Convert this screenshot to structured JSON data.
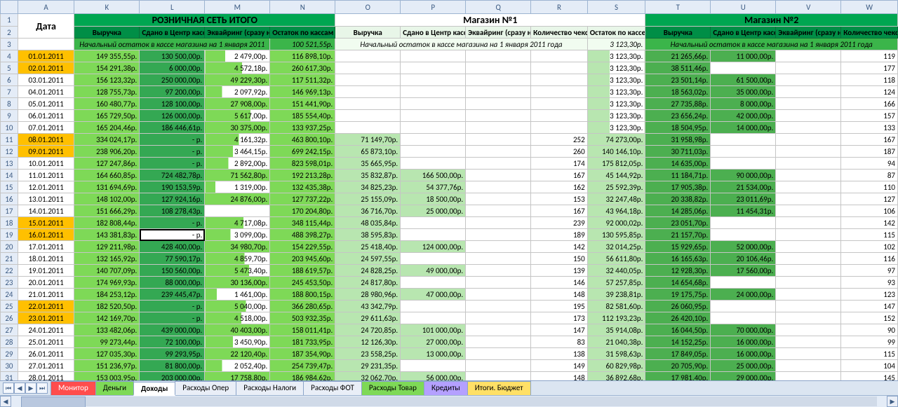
{
  "columns": [
    "",
    "A",
    "K",
    "L",
    "M",
    "N",
    "O",
    "P",
    "Q",
    "R",
    "S",
    "T",
    "U",
    "V",
    "W"
  ],
  "groups": {
    "date": "Дата",
    "retail": "РОЗНИЧНАЯ СЕТЬ ИТОГО",
    "shop1": "Магазин №1",
    "shop2": "Магазин №2"
  },
  "headers": {
    "K": "Выручка",
    "L": "Сдано в Центр кассу ВСЕГО",
    "M": "Эквайринг (сразу на счет)",
    "N": "Остаток по кассам",
    "O": "Выручка",
    "P": "Сдано в Центр кассу",
    "Q": "Эквайринг (сразу на счет)",
    "R": "Количество чеков",
    "S": "Остаток по кассе",
    "T": "Выручка",
    "U": "Сдано в Центр кассу",
    "V": "Эквайринг (сразу на счет)",
    "W": "Количество чеков"
  },
  "subheader": {
    "retail": "Начальный остаток в кассе магазина на 1 января 2011",
    "retail_amt": "100 521,55р.",
    "shop1": "Начальный остаток в кассе магазина на 1 января 2011 года",
    "shop1_amt": "3 123,30р.",
    "shop2": "Начальный остаток в кассе магазина на 1 января 2011 года"
  },
  "rows": [
    {
      "n": 4,
      "we": true,
      "A": "01.01.2011",
      "K": "149 355,55р.",
      "L": "130 500,00р.",
      "M": "2 479,00р.",
      "N": "116 898,10р.",
      "O": "",
      "P": "",
      "Q": "",
      "R": "",
      "S": "3 123,30р.",
      "T": "21 265,66р.",
      "U": "11 000,00р.",
      "V": "",
      "W": "119"
    },
    {
      "n": 5,
      "we": true,
      "A": "02.01.2011",
      "K": "154 291,38р.",
      "L": "6 000,00р.",
      "M": "4 572,18р.",
      "N": "260 617,30р.",
      "O": "",
      "P": "",
      "Q": "",
      "R": "",
      "S": "3 123,30р.",
      "T": "38 511,46р.",
      "U": "",
      "V": "",
      "W": "177"
    },
    {
      "n": 6,
      "A": "03.01.2011",
      "K": "156 123,32р.",
      "L": "250 000,00р.",
      "M": "49 229,30р.",
      "N": "117 511,32р.",
      "O": "",
      "P": "",
      "Q": "",
      "R": "",
      "S": "3 123,30р.",
      "T": "23 501,14р.",
      "U": "61 500,00р.",
      "V": "",
      "W": "118"
    },
    {
      "n": 7,
      "A": "04.01.2011",
      "K": "128 755,73р.",
      "L": "97 200,00р.",
      "M": "2 097,92р.",
      "N": "146 969,13р.",
      "O": "",
      "P": "",
      "Q": "",
      "R": "",
      "S": "3 123,30р.",
      "T": "18 563,02р.",
      "U": "35 000,00р.",
      "V": "",
      "W": "124"
    },
    {
      "n": 8,
      "A": "05.01.2011",
      "K": "160 480,77р.",
      "L": "128 100,00р.",
      "M": "27 908,00р.",
      "N": "151 441,90р.",
      "O": "",
      "P": "",
      "Q": "",
      "R": "",
      "S": "3 123,30р.",
      "T": "27 735,88р.",
      "U": "8 000,00р.",
      "V": "",
      "W": "166"
    },
    {
      "n": 9,
      "A": "06.01.2011",
      "K": "165 729,50р.",
      "L": "126 000,00р.",
      "M": "5 617,00р.",
      "N": "185 554,40р.",
      "O": "",
      "P": "",
      "Q": "",
      "R": "",
      "S": "3 123,30р.",
      "T": "23 656,24р.",
      "U": "42 000,00р.",
      "V": "",
      "W": "157"
    },
    {
      "n": 10,
      "A": "07.01.2011",
      "K": "165 204,46р.",
      "L": "186 446,61р.",
      "M": "30 375,00р.",
      "N": "133 937,25р.",
      "O": "",
      "P": "",
      "Q": "",
      "R": "",
      "S": "3 123,30р.",
      "T": "18 504,95р.",
      "U": "14 000,00р.",
      "V": "",
      "W": "133"
    },
    {
      "n": 11,
      "we": true,
      "A": "08.01.2011",
      "K": "334 024,17р.",
      "L": "-   р.",
      "M": "4 161,32р.",
      "N": "463 800,10р.",
      "O": "71 149,70р.",
      "P": "",
      "Q": "",
      "R": "252",
      "S": "74 273,00р.",
      "T": "31 958,98р.",
      "U": "",
      "V": "",
      "W": "167"
    },
    {
      "n": 12,
      "we": true,
      "A": "09.01.2011",
      "K": "238 906,20р.",
      "L": "-   р.",
      "M": "3 464,15р.",
      "N": "699 242,15р.",
      "O": "65 873,10р.",
      "P": "",
      "Q": "",
      "R": "260",
      "S": "140 146,10р.",
      "T": "30 711,03р.",
      "U": "",
      "V": "",
      "W": "187"
    },
    {
      "n": 13,
      "A": "10.01.2011",
      "K": "127 247,86р.",
      "L": "-   р.",
      "M": "2 892,00р.",
      "N": "823 598,01р.",
      "O": "35 665,95р.",
      "P": "",
      "Q": "",
      "R": "174",
      "S": "175 812,05р.",
      "T": "14 635,00р.",
      "U": "",
      "V": "",
      "W": "94"
    },
    {
      "n": 14,
      "A": "11.01.2011",
      "K": "164 660,85р.",
      "L": "724 482,78р.",
      "M": "71 562,80р.",
      "N": "192 213,28р.",
      "O": "35 832,87р.",
      "P": "166 500,00р.",
      "Q": "",
      "R": "167",
      "S": "45 144,92р.",
      "T": "11 184,71р.",
      "U": "90 000,00р.",
      "V": "",
      "W": "87"
    },
    {
      "n": 15,
      "A": "12.01.2011",
      "K": "131 694,69р.",
      "L": "190 153,59р.",
      "M": "1 319,00р.",
      "N": "132 435,38р.",
      "O": "34 825,23р.",
      "P": "54 377,76р.",
      "Q": "",
      "R": "162",
      "S": "25 592,39р.",
      "T": "17 905,38р.",
      "U": "21 534,00р.",
      "V": "",
      "W": "110"
    },
    {
      "n": 16,
      "A": "13.01.2011",
      "K": "148 102,00р.",
      "L": "127 924,16р.",
      "M": "24 876,00р.",
      "N": "127 737,22р.",
      "O": "25 155,09р.",
      "P": "18 500,00р.",
      "Q": "",
      "R": "153",
      "S": "32 247,48р.",
      "T": "20 338,82р.",
      "U": "23 011,69р.",
      "V": "",
      "W": "127"
    },
    {
      "n": 17,
      "A": "14.01.2011",
      "K": "151 666,29р.",
      "L": "108 278,43р.",
      "M": "",
      "N": "170 204,80р.",
      "O": "36 716,70р.",
      "P": "25 000,00р.",
      "Q": "",
      "R": "167",
      "S": "43 964,18р.",
      "T": "14 285,06р.",
      "U": "11 454,31р.",
      "V": "",
      "W": "106"
    },
    {
      "n": 18,
      "we": true,
      "A": "15.01.2011",
      "K": "182 808,44р.",
      "L": "-   р.",
      "M": "4 717,08р.",
      "N": "348 115,44р.",
      "O": "48 035,84р.",
      "P": "",
      "Q": "",
      "R": "239",
      "S": "92 000,02р.",
      "T": "23 051,70р.",
      "U": "",
      "V": "",
      "W": "142"
    },
    {
      "n": 19,
      "we": true,
      "sel": true,
      "A": "16.01.2011",
      "K": "143 381,83р.",
      "L": "-   р.",
      "M": "3 099,00р.",
      "N": "488 398,27р.",
      "O": "38 595,83р.",
      "P": "",
      "Q": "",
      "R": "189",
      "S": "130 595,85р.",
      "T": "21 157,70р.",
      "U": "",
      "V": "",
      "W": "115"
    },
    {
      "n": 20,
      "A": "17.01.2011",
      "K": "129 211,98р.",
      "L": "428 400,00р.",
      "M": "34 980,70р.",
      "N": "154 229,55р.",
      "O": "25 418,40р.",
      "P": "124 000,00р.",
      "Q": "",
      "R": "142",
      "S": "32 014,25р.",
      "T": "15 929,65р.",
      "U": "52 000,00р.",
      "V": "",
      "W": "102"
    },
    {
      "n": 21,
      "A": "18.01.2011",
      "K": "132 165,92р.",
      "L": "77 590,17р.",
      "M": "4 859,70р.",
      "N": "203 945,60р.",
      "O": "24 597,55р.",
      "P": "",
      "Q": "",
      "R": "150",
      "S": "56 611,80р.",
      "T": "16 165,63р.",
      "U": "20 106,46р.",
      "V": "",
      "W": "116"
    },
    {
      "n": 22,
      "A": "19.01.2011",
      "K": "140 707,09р.",
      "L": "150 560,00р.",
      "M": "5 473,40р.",
      "N": "188 619,57р.",
      "O": "24 828,25р.",
      "P": "49 000,00р.",
      "Q": "",
      "R": "139",
      "S": "32 440,05р.",
      "T": "12 928,30р.",
      "U": "17 560,00р.",
      "V": "",
      "W": "97"
    },
    {
      "n": 23,
      "A": "20.01.2011",
      "K": "174 969,93р.",
      "L": "88 000,00р.",
      "M": "30 136,00р.",
      "N": "245 453,50р.",
      "O": "24 817,80р.",
      "P": "",
      "Q": "",
      "R": "146",
      "S": "57 257,85р.",
      "T": "14 654,68р.",
      "U": "",
      "V": "",
      "W": "93"
    },
    {
      "n": 24,
      "A": "21.01.2011",
      "K": "184 253,12р.",
      "L": "239 445,47р.",
      "M": "1 461,00р.",
      "N": "188 800,15р.",
      "O": "28 980,96р.",
      "P": "47 000,00р.",
      "Q": "",
      "R": "148",
      "S": "39 238,81р.",
      "T": "19 175,75р.",
      "U": "24 000,00р.",
      "V": "",
      "W": "123"
    },
    {
      "n": 25,
      "we": true,
      "A": "22.01.2011",
      "K": "182 520,50р.",
      "L": "-   р.",
      "M": "5 040,00р.",
      "N": "366 280,65р.",
      "O": "43 342,79р.",
      "P": "",
      "Q": "",
      "R": "195",
      "S": "82 581,60р.",
      "T": "26 060,95р.",
      "U": "",
      "V": "",
      "W": "147"
    },
    {
      "n": 26,
      "we": true,
      "A": "23.01.2011",
      "K": "142 169,70р.",
      "L": "-   р.",
      "M": "4 518,00р.",
      "N": "503 932,35р.",
      "O": "29 611,63р.",
      "P": "",
      "Q": "",
      "R": "173",
      "S": "112 193,23р.",
      "T": "26 420,10р.",
      "U": "",
      "V": "",
      "W": "152"
    },
    {
      "n": 27,
      "A": "24.01.2011",
      "K": "133 482,06р.",
      "L": "439 000,00р.",
      "M": "40 403,00р.",
      "N": "158 011,41р.",
      "O": "24 720,85р.",
      "P": "101 000,00р.",
      "Q": "",
      "R": "147",
      "S": "35 914,08р.",
      "T": "16 044,50р.",
      "U": "70 000,00р.",
      "V": "",
      "W": "90"
    },
    {
      "n": 28,
      "A": "25.01.2011",
      "K": "99 273,44р.",
      "L": "72 100,00р.",
      "M": "3 450,90р.",
      "N": "181 733,95р.",
      "O": "12 126,30р.",
      "P": "27 000,00р.",
      "Q": "",
      "R": "83",
      "S": "21 040,38р.",
      "T": "14 152,25р.",
      "U": "16 000,00р.",
      "V": "",
      "W": "99"
    },
    {
      "n": 29,
      "A": "26.01.2011",
      "K": "127 035,30р.",
      "L": "99 293,95р.",
      "M": "22 120,40р.",
      "N": "187 354,90р.",
      "O": "23 558,25р.",
      "P": "13 000,00р.",
      "Q": "",
      "R": "138",
      "S": "31 598,63р.",
      "T": "17 849,05р.",
      "U": "16 000,00р.",
      "V": "",
      "W": "115"
    },
    {
      "n": 30,
      "A": "27.01.2011",
      "K": "151 236,97р.",
      "L": "81 800,00р.",
      "M": "2 052,40р.",
      "N": "254 739,47р.",
      "O": "29 231,35р.",
      "P": "",
      "Q": "",
      "R": "149",
      "S": "60 829,98р.",
      "T": "20 705,90р.",
      "U": "25 000,00р.",
      "V": "",
      "W": "104"
    },
    {
      "n": 31,
      "A": "28.01.2011",
      "K": "153 003,95р.",
      "L": "203 000,00р.",
      "M": "17 758,80р.",
      "N": "186 984,62р.",
      "O": "32 062,70р.",
      "P": "56 000,00р.",
      "Q": "",
      "R": "148",
      "S": "36 892,68р.",
      "T": "17 981,40р.",
      "U": "29 000,00р.",
      "V": "",
      "W": "145"
    }
  ],
  "tabs": [
    {
      "label": "Монитор",
      "cls": "red"
    },
    {
      "label": "Деньги",
      "cls": "green"
    },
    {
      "label": "Доходы",
      "cls": "active"
    },
    {
      "label": "Расходы Опер",
      "cls": ""
    },
    {
      "label": "Расходы Налоги",
      "cls": ""
    },
    {
      "label": "Расходы ФОТ",
      "cls": ""
    },
    {
      "label": "Расходы Товар",
      "cls": "green"
    },
    {
      "label": "Кредиты",
      "cls": "purple"
    },
    {
      "label": "Итоги. Бюджет",
      "cls": "yellow"
    }
  ]
}
